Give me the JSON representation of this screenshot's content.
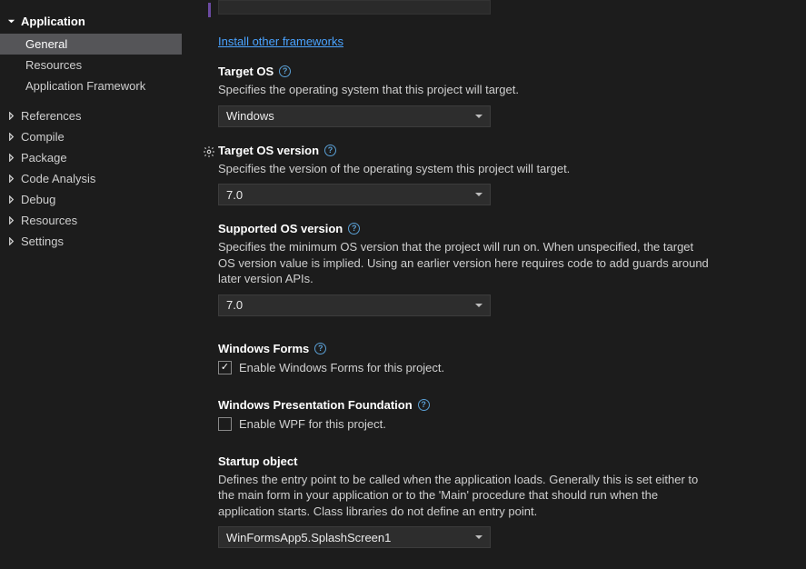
{
  "sidebar": {
    "header": "Application",
    "children": [
      {
        "label": "General",
        "selected": true
      },
      {
        "label": "Resources",
        "selected": false
      },
      {
        "label": "Application Framework",
        "selected": false
      }
    ],
    "top_items": [
      "References",
      "Compile",
      "Package",
      "Code Analysis",
      "Debug",
      "Resources",
      "Settings"
    ]
  },
  "main": {
    "install_link": "Install other frameworks",
    "target_os": {
      "label": "Target OS",
      "desc": "Specifies the operating system that this project will target.",
      "value": "Windows"
    },
    "target_os_version": {
      "label": "Target OS version",
      "desc": "Specifies the version of the operating system this project will target.",
      "value": "7.0"
    },
    "supported_os_version": {
      "label": "Supported OS version",
      "desc": "Specifies the minimum OS version that the project will run on. When unspecified, the target OS version value is implied. Using an earlier version here requires code to add guards around later version APIs.",
      "value": "7.0"
    },
    "winforms": {
      "label": "Windows Forms",
      "checkbox_label": "Enable Windows Forms for this project.",
      "checked": true
    },
    "wpf": {
      "label": "Windows Presentation Foundation",
      "checkbox_label": "Enable WPF for this project.",
      "checked": false
    },
    "startup": {
      "label": "Startup object",
      "desc": "Defines the entry point to be called when the application loads. Generally this is set either to the main form in your application or to the 'Main' procedure that should run when the application starts. Class libraries do not define an entry point.",
      "value": "WinFormsApp5.SplashScreen1"
    }
  }
}
